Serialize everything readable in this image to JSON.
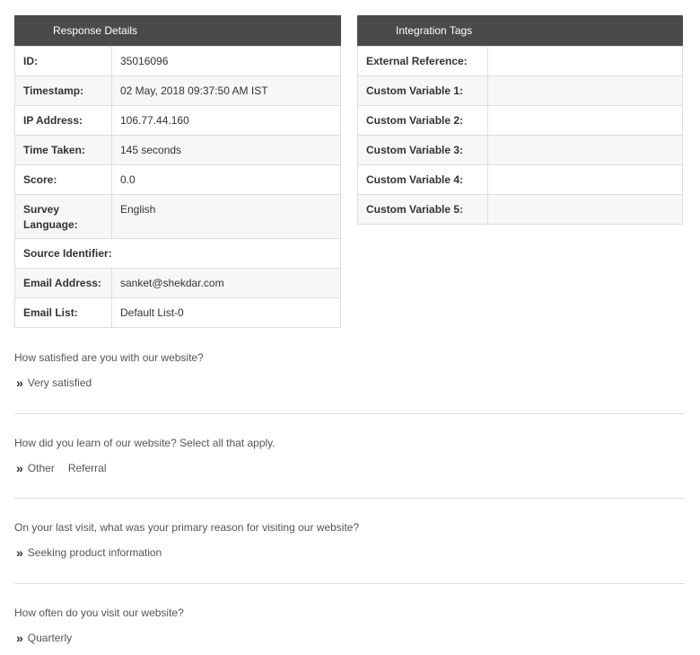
{
  "response_details": {
    "title": "Response Details",
    "rows": [
      {
        "label": "ID:",
        "value": "35016096"
      },
      {
        "label": "Timestamp:",
        "value": "02 May, 2018 09:37:50 AM IST"
      },
      {
        "label": "IP Address:",
        "value": "106.77.44.160"
      },
      {
        "label": "Time Taken:",
        "value": "145 seconds"
      },
      {
        "label": "Score:",
        "value": "0.0"
      },
      {
        "label": "Survey Language:",
        "value": "English"
      },
      {
        "label": "Source Identifier:",
        "value": ""
      },
      {
        "label": "Email Address:",
        "value": "sanket@shekdar.com"
      },
      {
        "label": "Email List:",
        "value": "Default List-0"
      }
    ]
  },
  "integration_tags": {
    "title": "Integration Tags",
    "rows": [
      {
        "label": "External Reference:",
        "value": ""
      },
      {
        "label": "Custom Variable 1:",
        "value": ""
      },
      {
        "label": "Custom Variable 2:",
        "value": ""
      },
      {
        "label": "Custom Variable 3:",
        "value": ""
      },
      {
        "label": "Custom Variable 4:",
        "value": ""
      },
      {
        "label": "Custom Variable 5:",
        "value": ""
      }
    ]
  },
  "answer_marker": "»",
  "questions": [
    {
      "question": "How satisfied are you with our website?",
      "answers": [
        "Very satisfied"
      ]
    },
    {
      "question": "How did you learn of our website? Select all that apply.",
      "answers": [
        "Other",
        "Referral"
      ]
    },
    {
      "question": "On your last visit, what was your primary reason for visiting our website?",
      "answers": [
        "Seeking product information"
      ]
    },
    {
      "question": "How often do you visit our website?",
      "answers": [
        "Quarterly"
      ]
    }
  ]
}
